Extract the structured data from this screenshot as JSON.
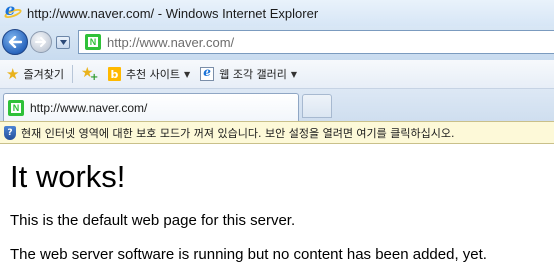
{
  "window": {
    "title": "http://www.naver.com/ - Windows Internet Explorer"
  },
  "nav": {
    "address": "http://www.naver.com/"
  },
  "favorites_bar": {
    "favorites_label": "즐겨찾기",
    "suggested_sites_label": "추천 사이트",
    "web_slice_gallery_label": "웹 조각 갤러리"
  },
  "tabs": [
    {
      "label": "http://www.naver.com/"
    }
  ],
  "infobar": {
    "message": "현재 인터넷 영역에 대한 보호 모드가 꺼져 있습니다. 보안 설정을 열려면 여기를 클릭하십시오."
  },
  "page": {
    "heading": "It works!",
    "para1": "This is the default web page for this server.",
    "para2": "The web server software is running but no content has been added, yet."
  },
  "colors": {
    "naver_green": "#2fc139",
    "infobar_bg": "#fdf9d8",
    "ie_blue": "#1a73d9"
  }
}
